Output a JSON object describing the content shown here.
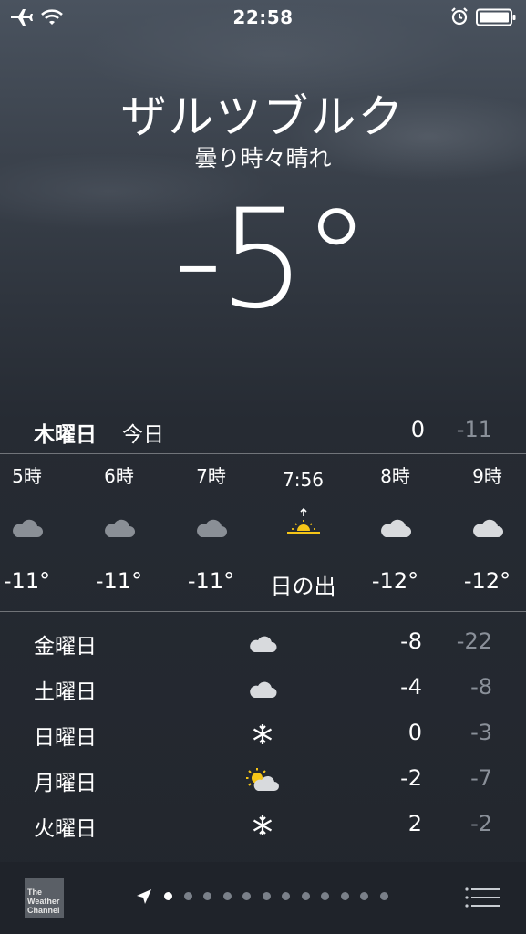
{
  "status_bar": {
    "time": "22:58",
    "icons": [
      "airplane-icon",
      "wifi-icon",
      "alarm-icon",
      "battery-icon"
    ]
  },
  "location": {
    "city": "ザルツブルク",
    "condition": "曇り時々晴れ",
    "temperature": "-5°"
  },
  "today": {
    "day": "木曜日",
    "label": "今日",
    "high": "0",
    "low": "-11"
  },
  "hourly": [
    {
      "time": "5時",
      "icon": "cloud-icon",
      "temp": "-11°"
    },
    {
      "time": "6時",
      "icon": "cloud-icon",
      "temp": "-11°"
    },
    {
      "time": "7時",
      "icon": "cloud-icon",
      "temp": "-11°"
    },
    {
      "time": "7:56",
      "icon": "sunrise-icon",
      "temp": "日の出"
    },
    {
      "time": "8時",
      "icon": "cloud-icon",
      "temp": "-12°"
    },
    {
      "time": "9時",
      "icon": "cloud-icon",
      "temp": "-12°"
    }
  ],
  "daily": [
    {
      "day": "金曜日",
      "icon": "cloud-icon",
      "high": "-8",
      "low": "-22"
    },
    {
      "day": "土曜日",
      "icon": "cloud-icon",
      "high": "-4",
      "low": "-8"
    },
    {
      "day": "日曜日",
      "icon": "snowflake-icon",
      "high": "0",
      "low": "-3"
    },
    {
      "day": "月曜日",
      "icon": "partly-sunny-icon",
      "high": "-2",
      "low": "-7"
    },
    {
      "day": "火曜日",
      "icon": "snowflake-icon",
      "high": "2",
      "low": "-2"
    }
  ],
  "toolbar": {
    "logo_lines": [
      "The",
      "Weather",
      "Channel"
    ],
    "page_count": 12,
    "current_page": 0
  },
  "colors": {
    "text": "#ffffff",
    "low_temp": "#8a9099",
    "sun": "#f5c518"
  }
}
